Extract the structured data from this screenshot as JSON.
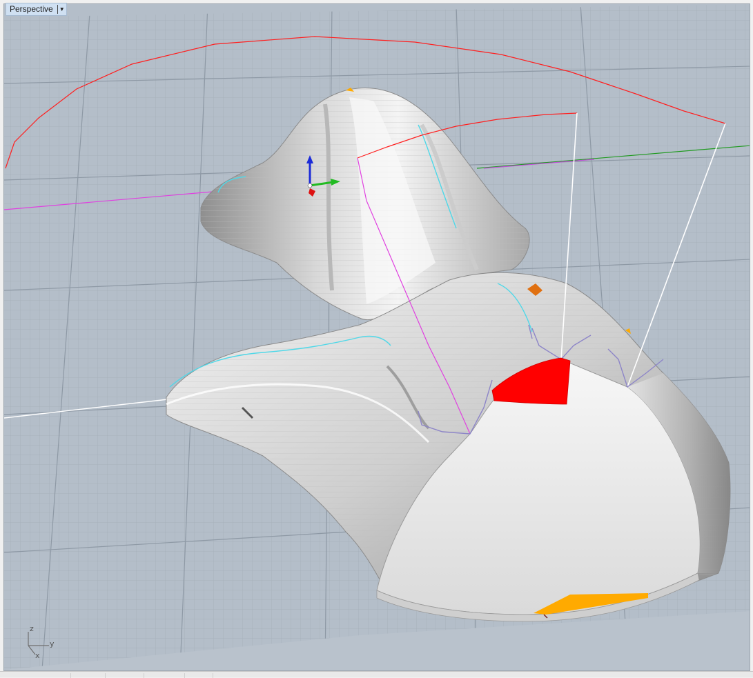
{
  "viewport": {
    "title": "Perspective",
    "dropdown_icon": "triangle-down-icon"
  },
  "axis_widget": {
    "z": "z",
    "y": "y",
    "x": "x"
  },
  "colors": {
    "grid_background": "#b4bec9",
    "grid_minor": "#a7b1bc",
    "grid_major": "#8e99a5",
    "surface": "#e9e9e9",
    "surface_shadow": "#9a9a9a",
    "curve_red": "#ff1f1f",
    "curve_magenta": "#e040e0",
    "curve_green": "#1f9a1f",
    "curve_cyan": "#4fd8e8",
    "curve_white": "#ffffff",
    "gumball_blue": "#1c2bd8",
    "gumball_green": "#22bb22",
    "gumball_red": "#dd1111",
    "highlight_red": "#ff0000",
    "highlight_orange": "#ffaa00",
    "marker_orange": "#e07010",
    "control_purple": "#8d85c8"
  }
}
